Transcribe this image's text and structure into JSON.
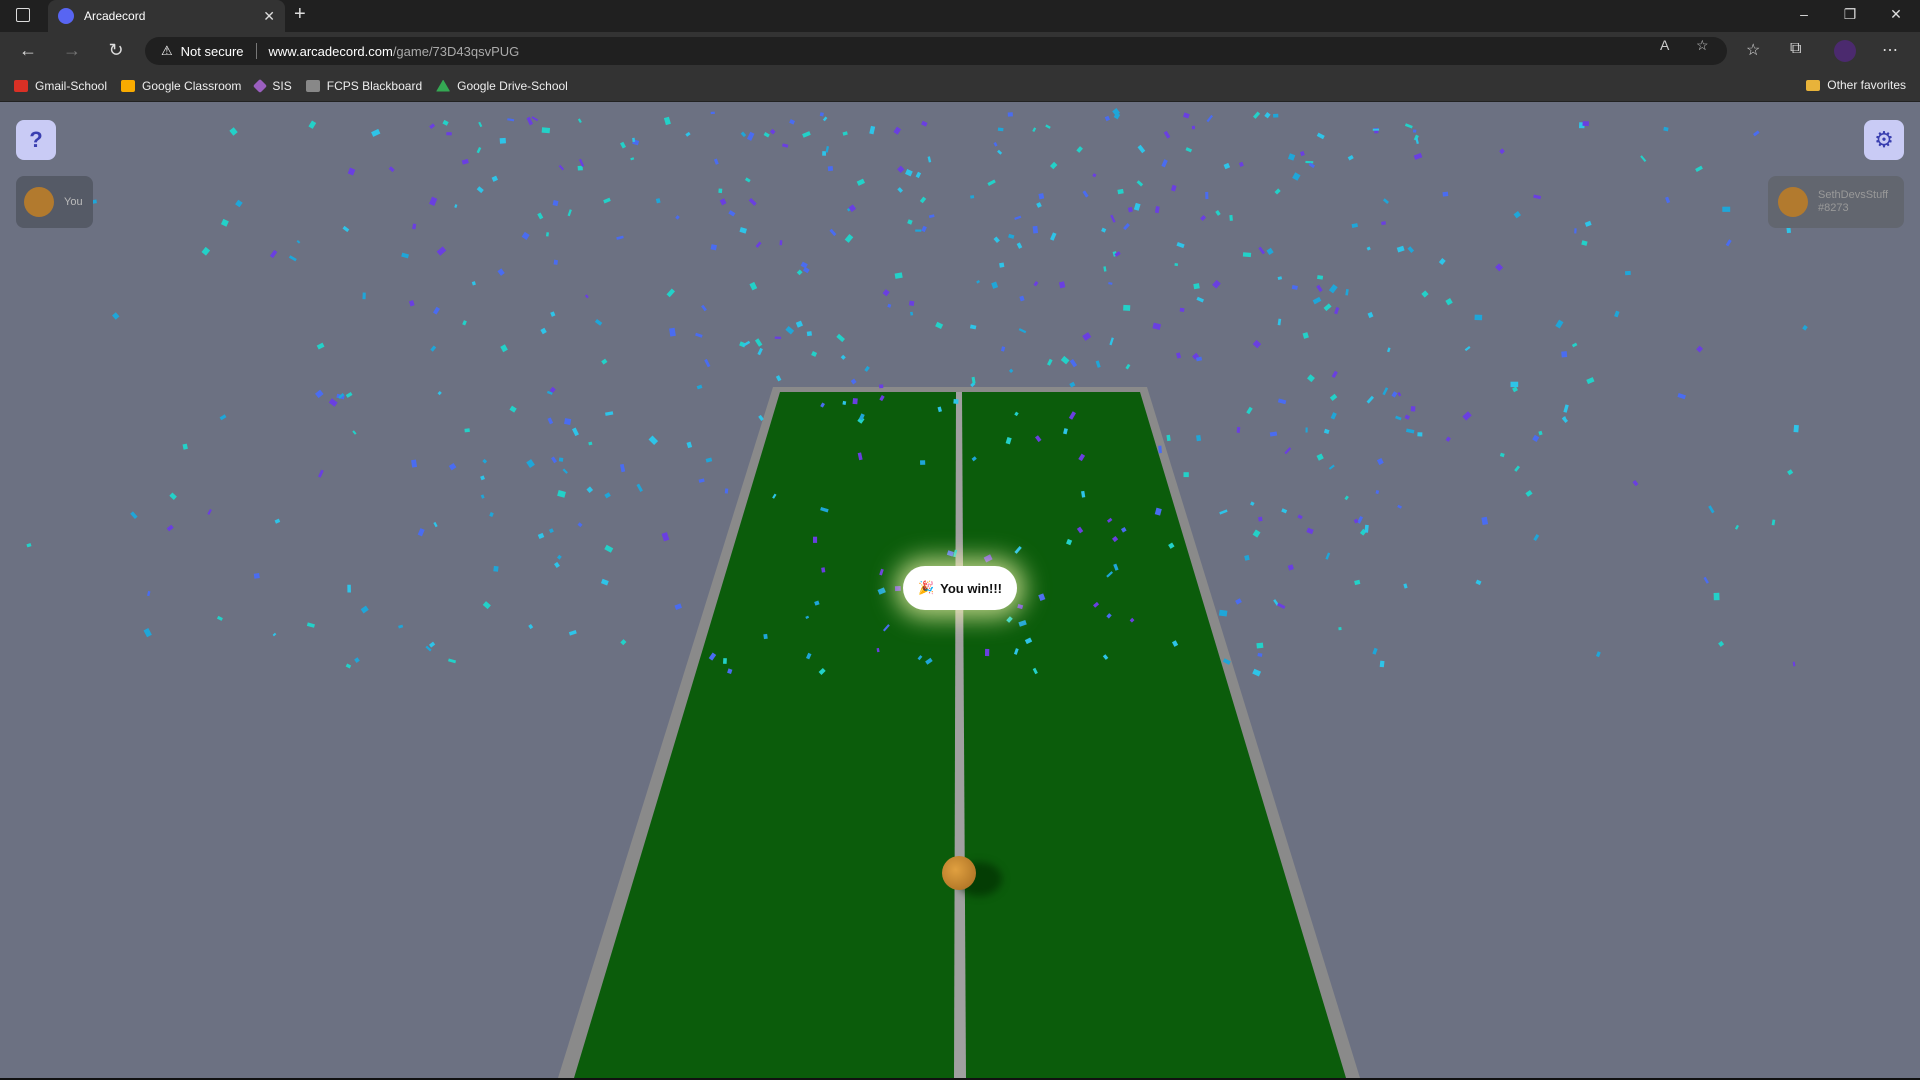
{
  "browser": {
    "tab_title": "Arcadecord",
    "security_label": "Not secure",
    "url_host": "www.arcadecord.com",
    "url_path": "/game/73D43qsvPUG",
    "bookmarks": [
      {
        "label": "Gmail-School",
        "color": "#d93025"
      },
      {
        "label": "Google Classroom",
        "color": "#f9ab00"
      },
      {
        "label": "SIS",
        "color": "#9b5fc0"
      },
      {
        "label": "FCPS Blackboard",
        "color": "#888888"
      },
      {
        "label": "Google Drive-School",
        "color": "#34a853"
      }
    ],
    "other_favorites": "Other favorites"
  },
  "game": {
    "help_label": "?",
    "player_left": {
      "name": "You"
    },
    "player_right": {
      "name": "SethDevsStuff",
      "tag": "#8273"
    },
    "win_message": "You win!!!",
    "win_emoji": "🎉",
    "colors": {
      "table": "#0b5c0b",
      "table_border": "#8a8a8a",
      "net": "#a0a0a0",
      "background": "#6c7182",
      "confetti": [
        "#2ec4e8",
        "#6a3fe0",
        "#1fa6d8",
        "#4a6cf0",
        "#23d1c8"
      ]
    }
  }
}
